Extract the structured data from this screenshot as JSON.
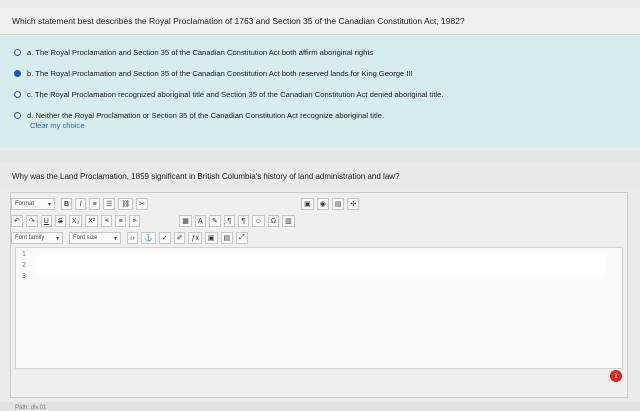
{
  "question1": {
    "text": "Which statement best describes the Royal Proclamation of 1763 and Section 35 of the Canadian Constitution Act, 1982?",
    "options": [
      {
        "label": "a. The Royal Proclamation and Section 35 of the Canadian Constitution Act both affirm aboriginal rights",
        "selected": false
      },
      {
        "label": "b. The Royal Proclamation and Section 35 of the Canadian Constitution Act both reserved lands for King George III",
        "selected": true
      },
      {
        "label": "c. The Royal Proclamation recognized aboriginal title and Section 35 of the Canadian Constitution Act denied aboriginal title.",
        "selected": false
      },
      {
        "label": "d. Neither the Royal Proclamation or Section 35 of the Canadian Constitution Act recognize aboriginal title.",
        "selected": false
      }
    ],
    "clear_label": "Clear my choice"
  },
  "question2": {
    "text": "Why was the Land Proclamation, 1859 significant in British Columbia's history of land administration and law?",
    "toolbar": {
      "format_label": "Format",
      "font_family_label": "Font family",
      "font_size_label": "Font size"
    },
    "line_numbers": [
      "1",
      "2",
      "3"
    ],
    "path_label": "Path: div.01"
  },
  "notification_count": "1"
}
